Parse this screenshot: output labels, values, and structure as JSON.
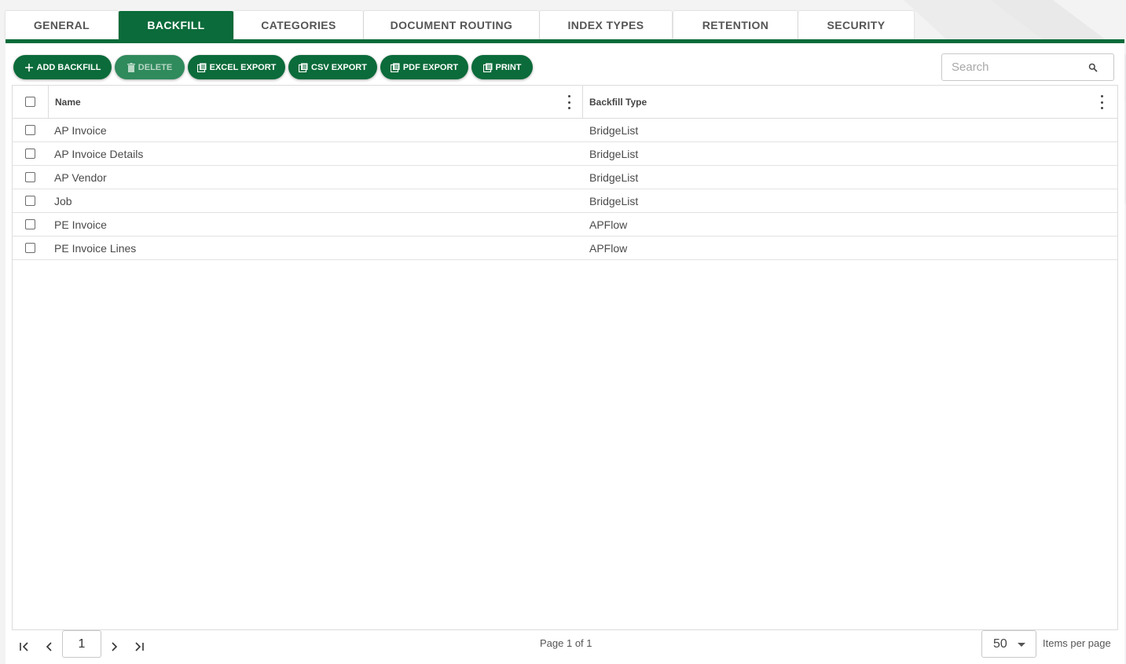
{
  "tabs": [
    {
      "label": "GENERAL",
      "active": false
    },
    {
      "label": "BACKFILL",
      "active": true
    },
    {
      "label": "CATEGORIES",
      "active": false
    },
    {
      "label": "DOCUMENT ROUTING",
      "active": false
    },
    {
      "label": "INDEX TYPES",
      "active": false
    },
    {
      "label": "RETENTION",
      "active": false
    },
    {
      "label": "SECURITY",
      "active": false
    }
  ],
  "toolbar": {
    "add_label": "ADD BACKFILL",
    "delete_label": "DELETE",
    "excel_label": "EXCEL EXPORT",
    "csv_label": "CSV EXPORT",
    "pdf_label": "PDF EXPORT",
    "print_label": "PRINT"
  },
  "search": {
    "placeholder": "Search"
  },
  "grid": {
    "columns": {
      "name": "Name",
      "type": "Backfill Type"
    },
    "rows": [
      {
        "name": "AP Invoice",
        "type": "BridgeList"
      },
      {
        "name": "AP Invoice Details",
        "type": "BridgeList"
      },
      {
        "name": "AP Vendor",
        "type": "BridgeList"
      },
      {
        "name": "Job",
        "type": "BridgeList"
      },
      {
        "name": "PE Invoice",
        "type": "APFlow"
      },
      {
        "name": "PE Invoice Lines",
        "type": "APFlow"
      }
    ]
  },
  "pager": {
    "page_value": "1",
    "info": "Page 1 of 1",
    "page_size": "50",
    "page_size_label": "Items per page"
  },
  "colors": {
    "brand": "#0b6b3a"
  }
}
